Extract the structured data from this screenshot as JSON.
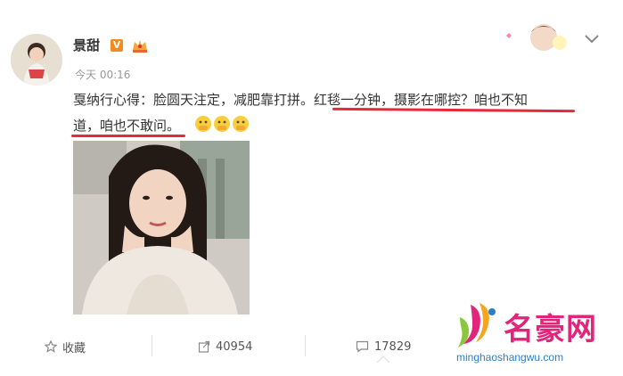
{
  "post": {
    "author": "景甜",
    "verified_badge": "V",
    "timestamp": "今天 00:16",
    "text_part1": "戛纳行心得：脸圆天注定，减肥靠打拼。红毯一分钟，摄影在哪控？咱也不知",
    "text_part2": "道，咱也不敢问。"
  },
  "actions": {
    "favorite": {
      "icon": "star-icon",
      "label": "收藏"
    },
    "repost": {
      "icon": "share-icon",
      "count": "40954"
    },
    "comment": {
      "icon": "comment-icon",
      "count": "17829"
    }
  },
  "watermark": {
    "title": "名豪网",
    "url": "minghaoshangwu.com"
  },
  "colors": {
    "underline": "#e8283c",
    "badge": "#f58a1f",
    "watermark_pink": "#e1257a",
    "watermark_blue": "#2a80c8"
  }
}
